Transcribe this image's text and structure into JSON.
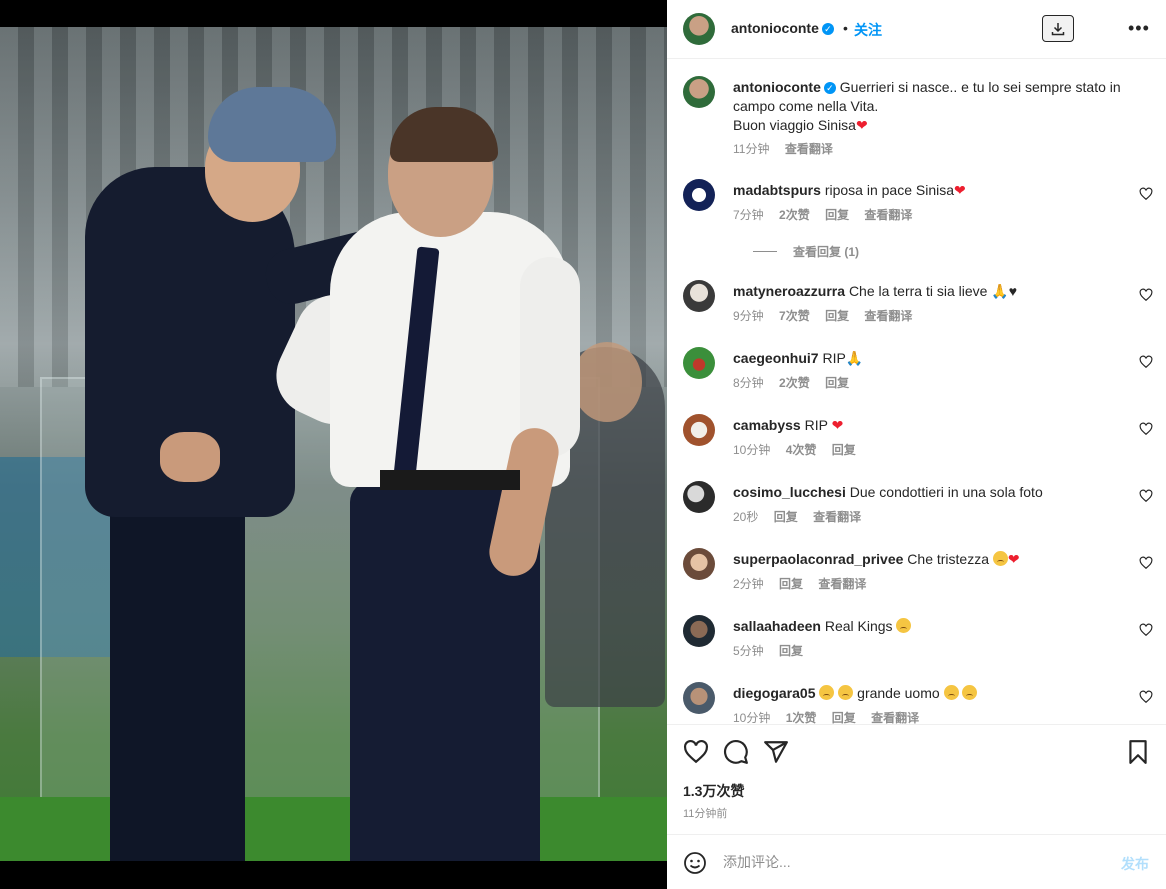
{
  "header": {
    "username": "antonioconte",
    "verified_icon": "verified-badge-icon",
    "separator": "•",
    "follow_label": "关注",
    "download_icon": "download-icon",
    "more_icon": "more-options-icon"
  },
  "caption": {
    "username": "antonioconte",
    "text": "Guerrieri si nasce.. e tu lo sei sempre stato in campo come nella Vita.",
    "line2": "Buon viaggio Sinisa",
    "time": "11分钟",
    "translate": "查看翻译"
  },
  "comments": [
    {
      "username": "madabtspurs",
      "text": "riposa in pace Sinisa",
      "emoji": "red-heart",
      "time": "7分钟",
      "likes": "2次赞",
      "reply": "回复",
      "translate": "查看翻译",
      "view_replies": "查看回复 (1)"
    },
    {
      "username": "matyneroazzurra",
      "text": "Che la terra ti sia lieve",
      "emoji": "folded-hands-black-heart",
      "time": "9分钟",
      "likes": "7次赞",
      "reply": "回复",
      "translate": "查看翻译"
    },
    {
      "username": "caegeonhui7",
      "text": "RIP",
      "emoji": "folded-hands",
      "time": "8分钟",
      "likes": "2次赞",
      "reply": "回复"
    },
    {
      "username": "camabyss",
      "text": "RIP",
      "emoji": "red-heart",
      "time": "10分钟",
      "likes": "4次赞",
      "reply": "回复"
    },
    {
      "username": "cosimo_lucchesi",
      "text": "Due condottieri in una sola foto",
      "time": "20秒",
      "reply": "回复",
      "translate": "查看翻译"
    },
    {
      "username": "superpaolaconrad_privee",
      "text": "Che tristezza",
      "emoji": "sad-face-red-heart",
      "time": "2分钟",
      "reply": "回复",
      "translate": "查看翻译"
    },
    {
      "username": "sallaahadeen",
      "text": "Real Kings",
      "emoji": "sad-face",
      "time": "5分钟",
      "reply": "回复"
    },
    {
      "username": "diegogara05",
      "text": "grande uomo",
      "emoji": "sad-faces",
      "time": "10分钟",
      "likes": "1次赞",
      "reply": "回复",
      "translate": "查看翻译"
    }
  ],
  "actions": {
    "like_icon": "heart-outline-icon",
    "comment_icon": "comment-icon",
    "share_icon": "share-icon",
    "save_icon": "bookmark-icon",
    "likes_count": "1.3万次赞",
    "time_ago": "11分钟前"
  },
  "add_comment": {
    "emoji_icon": "smiley-icon",
    "placeholder": "添加评论...",
    "post_label": "发布"
  },
  "colors": {
    "accent": "#0095f6",
    "post_disabled": "#b2dffc",
    "heart_red": "#ed1f2f",
    "muted_text": "#8e8e8e"
  }
}
